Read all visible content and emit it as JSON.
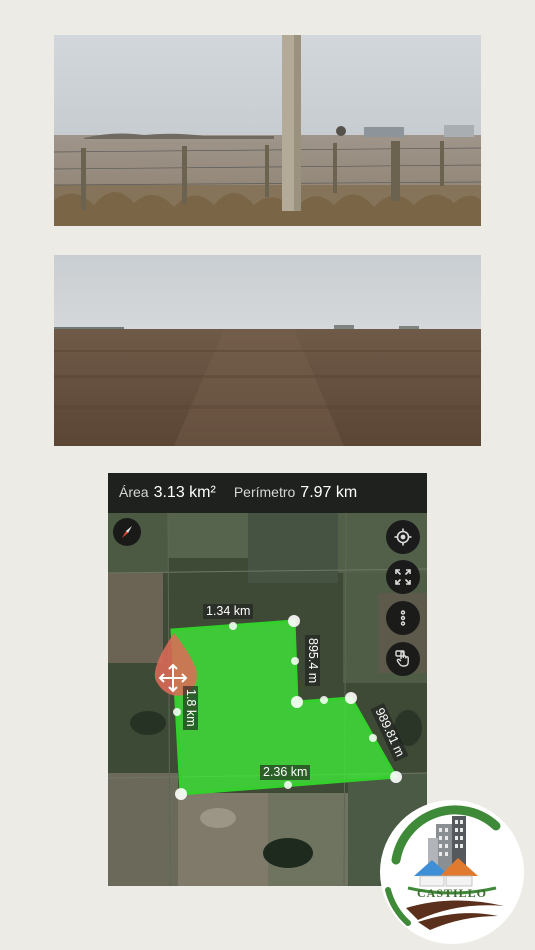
{
  "measure_bar": {
    "area_label": "Área",
    "area_value": "3.13 km²",
    "perimeter_label": "Perímetro",
    "perimeter_value": "7.97 km"
  },
  "edge_labels": {
    "top": "1.34 km",
    "right_upper": "895.4 m",
    "left": "1.8 km",
    "right_lower": "989.81 m",
    "bottom": "2.36 km"
  },
  "icons": {
    "compass": "compass-icon",
    "locate": "crosshair-icon",
    "fullscreen": "expand-icon",
    "more": "more-vertical-icon",
    "touch": "touch-icon",
    "move": "move-arrows-icon"
  },
  "logo": {
    "text": "CASTILLO"
  },
  "colors": {
    "polygon_fill": "#3fe53a",
    "polygon_stroke": "#33d02c",
    "topbar": "#1c1e1c",
    "background": "#ecebe6",
    "logo_green": "#3f8a39",
    "logo_brown": "#5a2f1c"
  }
}
